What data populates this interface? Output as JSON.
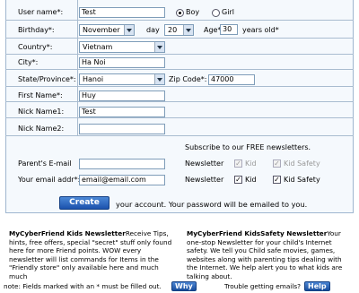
{
  "form": {
    "username": {
      "label": "User name*:",
      "value": "Test"
    },
    "gender": {
      "boy_label": "Boy",
      "girl_label": "Girl",
      "selected": "Boy"
    },
    "birthday": {
      "label": "Birthday*:",
      "month": "November",
      "day_label": "day",
      "day": "20",
      "age_label": "Age*",
      "age": "30",
      "age_suffix": "years old*"
    },
    "country": {
      "label": "Country*:",
      "value": "Vietnam"
    },
    "city": {
      "label": "City*:",
      "value": "Ha Noi"
    },
    "state": {
      "label": "State/Province*:",
      "value": "Hanoi",
      "zip_label": "Zip Code*:",
      "zip": "47000"
    },
    "first_name": {
      "label": "First Name*:",
      "value": "Huy"
    },
    "nick1": {
      "label": "Nick Name1:",
      "value": "Test"
    },
    "nick2": {
      "label": "Nick Name2:",
      "value": ""
    },
    "subscribe_text": "Subscribe to our FREE newsletters.",
    "parent_email": {
      "label": "Parent's E-mail",
      "value": ""
    },
    "email": {
      "label": "Your email addr*:",
      "value": "email@email.com"
    },
    "newsletter_label": "Newsletter",
    "kid_label": "Kid",
    "kid_safety_label": "Kid Safety",
    "create_button": "Create",
    "account_text": "your account.  Your password will be emailed to you."
  },
  "info": {
    "left_title": "MyCyberFriend Kids Newsletter",
    "left_body": "Receive Tips, hints, free offers, special \"secret\" stuff only found here for more Friend points. WOW every newsletter will list commands for Items in the \"Friendly store\" only available here and much much",
    "right_title": "MyCyberFriend KidsSafety Newsletter",
    "right_body": "Your one-stop Newsletter for your child's Internet safety. We tell you Child safe movies, games, websites along with parenting tips dealing with the Internet. We help alert you to what kids are talking about.",
    "note": "note: Fields marked with an * must be filled out.",
    "why_button": "Why",
    "trouble_text": "Trouble getting emails?",
    "help_button": "Help"
  }
}
